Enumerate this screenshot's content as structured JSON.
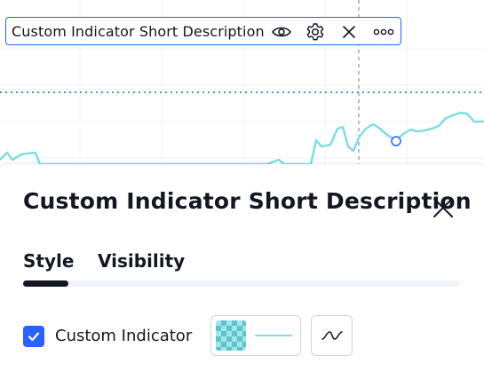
{
  "legend": {
    "title": "Custom Indicator Short Description",
    "icons": [
      "eye-icon",
      "gear-icon",
      "close-icon",
      "more-icon"
    ]
  },
  "panel": {
    "title": "Custom Indicator Short Description",
    "tabs": [
      {
        "label": "Style",
        "active": true
      },
      {
        "label": "Visibility",
        "active": false
      }
    ],
    "plot": {
      "checkbox_checked": true,
      "label": "Custom Indicator"
    }
  },
  "colors": {
    "series_line": "#7fdde3",
    "horizontal_level": "#22b0b8",
    "accent_blue": "#2962ff",
    "text": "#131722",
    "swatch_dark": "#5bc4cc",
    "swatch_light": "#a3e6ea"
  }
}
